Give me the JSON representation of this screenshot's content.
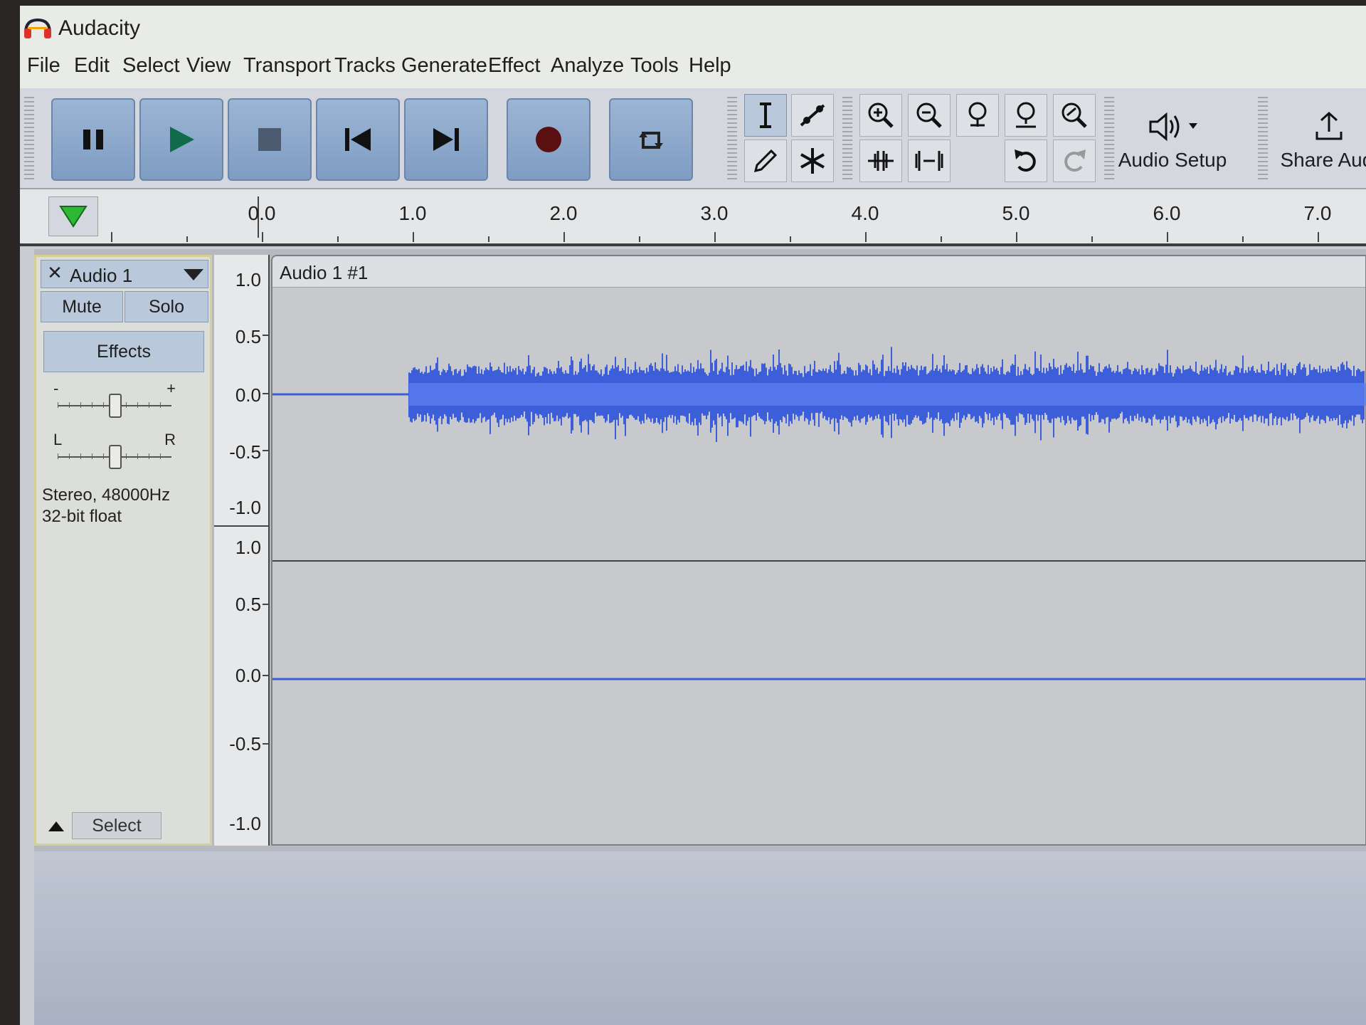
{
  "app": {
    "title": "Audacity"
  },
  "menu": [
    "File",
    "Edit",
    "Select",
    "View",
    "Transport",
    "Tracks",
    "Generate",
    "Effect",
    "Analyze",
    "Tools",
    "Help"
  ],
  "toolbar": {
    "transport": [
      "pause-icon",
      "play-icon",
      "stop-icon",
      "skip-start-icon",
      "skip-end-icon",
      "record-icon",
      "loop-icon"
    ],
    "audio_setup_label": "Audio Setup",
    "share_audio_label": "Share Audi"
  },
  "ruler": {
    "labels": [
      "0.0",
      "1.0",
      "2.0",
      "3.0",
      "4.0",
      "5.0",
      "6.0",
      "7.0"
    ]
  },
  "track": {
    "name": "Audio 1",
    "close": "✕",
    "mute_label": "Mute",
    "solo_label": "Solo",
    "effects_label": "Effects",
    "gain_minus": "-",
    "gain_plus": "+",
    "pan_left": "L",
    "pan_right": "R",
    "info_line1": "Stereo, 48000Hz",
    "info_line2": "32-bit float",
    "select_label": "Select",
    "clip_title": "Audio 1 #1",
    "channel1_scale": [
      "1.0",
      "0.5",
      "0.0",
      "-0.5",
      "-1.0"
    ],
    "channel2_scale": [
      "1.0",
      "0.5",
      "0.0",
      "-0.5",
      "-1.0"
    ]
  },
  "colors": {
    "waveform": "#3c5ed8",
    "waveform_rms": "#5b7ff0",
    "accent": "#7f9cc2"
  }
}
